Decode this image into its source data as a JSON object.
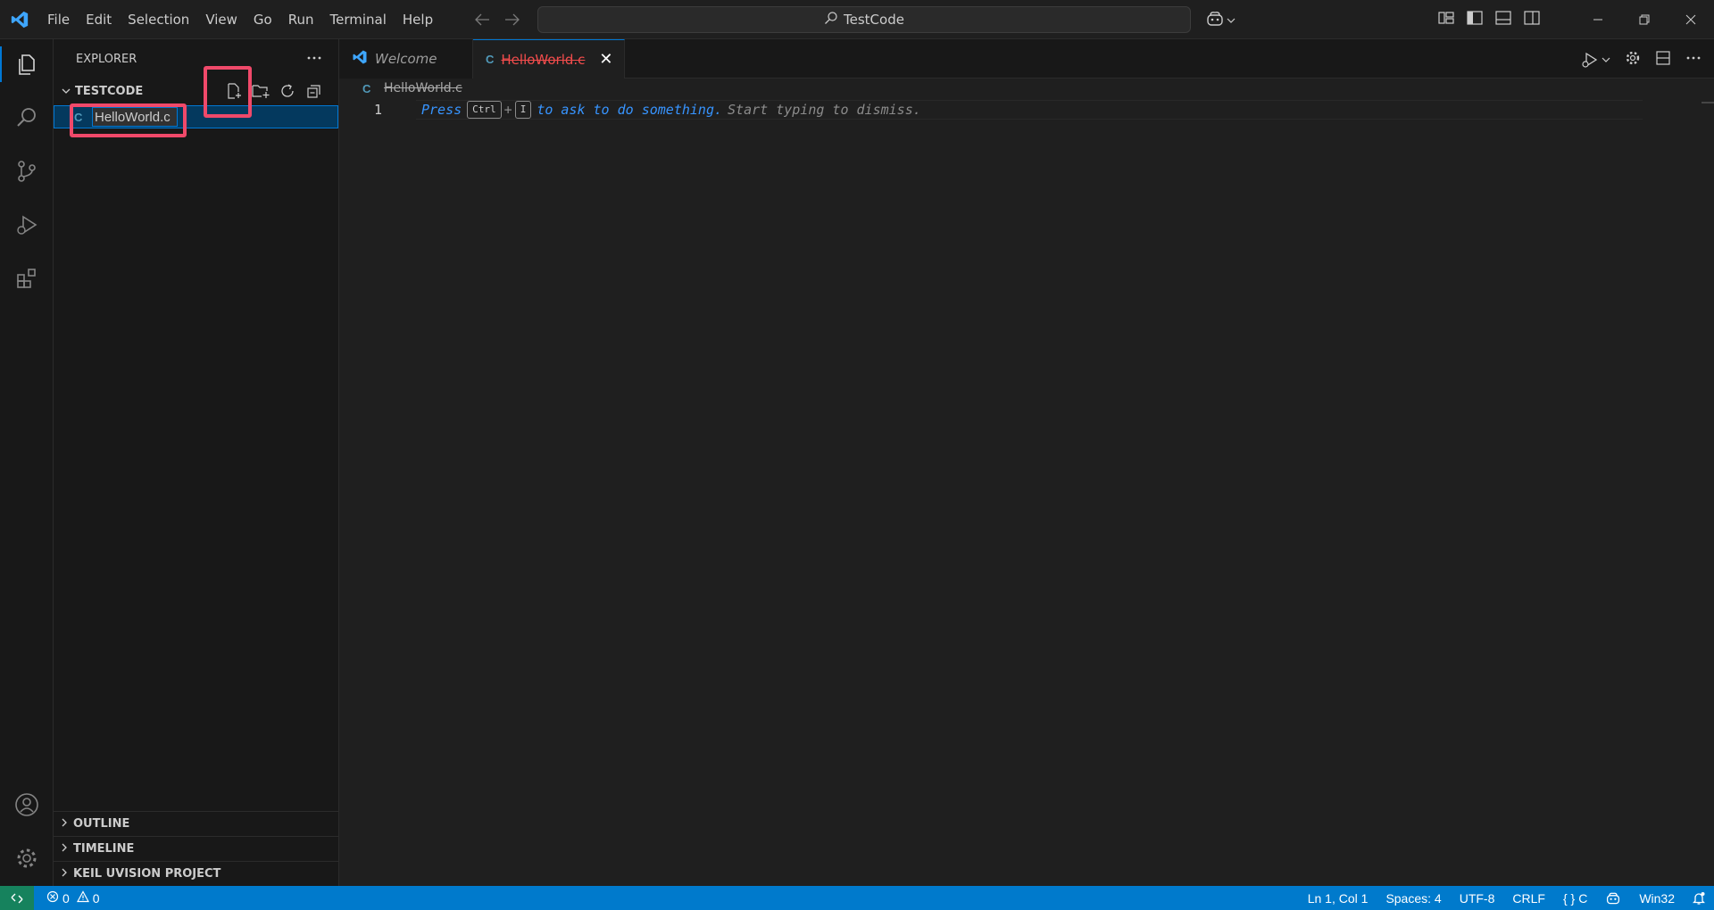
{
  "menu": [
    "File",
    "Edit",
    "Selection",
    "View",
    "Go",
    "Run",
    "Terminal",
    "Help"
  ],
  "search": {
    "text": "TestCode"
  },
  "sidebar": {
    "title": "EXPLORER",
    "folder": "TESTCODE",
    "file_icon_letter": "C",
    "rename_value": "HelloWorld.c",
    "sections": [
      "OUTLINE",
      "TIMELINE",
      "KEIL UVISION PROJECT"
    ]
  },
  "tabs": {
    "welcome": "Welcome",
    "active_icon": "C",
    "active": "HelloWorld.c",
    "close_glyph": "✕"
  },
  "breadcrumb": {
    "icon": "C",
    "file": "HelloWorld.c"
  },
  "editor": {
    "line_number": "1",
    "hint_press": "Press",
    "kbd_ctrl": "Ctrl",
    "plus": "+",
    "kbd_i": "I",
    "hint_ask": "to ask to do something.",
    "hint_dismiss": "Start typing to dismiss."
  },
  "status": {
    "errors": "0",
    "warnings": "0",
    "position": "Ln 1, Col 1",
    "spaces": "Spaces: 4",
    "encoding": "UTF-8",
    "eol": "CRLF",
    "language": "C",
    "platform": "Win32"
  },
  "colors": {
    "accent": "#0078d4",
    "statusbar": "#007acc",
    "highlight": "#f0496a",
    "error_tab": "#f14c4c"
  }
}
